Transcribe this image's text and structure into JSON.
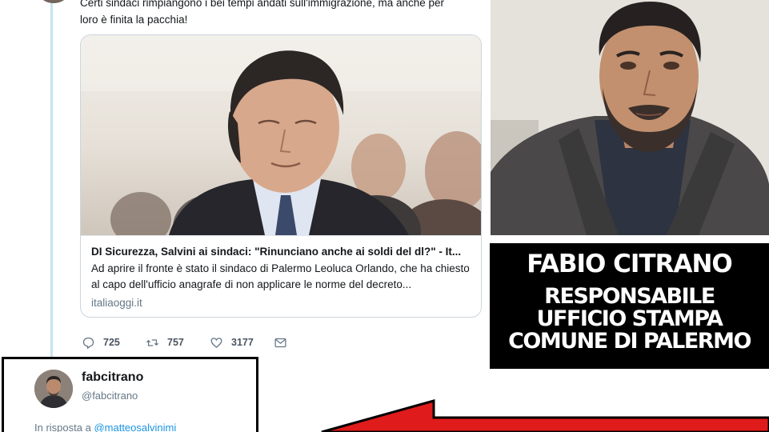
{
  "tweet": {
    "text": "Certi sindaci rimpiangono i bei tempi andati sull'immigrazione, ma anche per loro è finita la pacchia!",
    "card": {
      "title": "DI Sicurezza, Salvini ai sindaci: \"Rinunciano anche ai soldi del dl?\" - It...",
      "description": "Ad aprire il fronte è stato il sindaco di Palermo Leoluca Orlando, che ha chiesto al capo dell'ufficio anagrafe di non applicare le norme del decreto...",
      "domain": "italiaoggi.it"
    },
    "actions": {
      "replies": "725",
      "retweets": "757",
      "likes": "3177"
    }
  },
  "reply": {
    "display_name": "fabcitrano",
    "handle": "@fabcitrano",
    "in_reply_prefix": "In risposta a",
    "in_reply_handle": "@matteosalvinimi"
  },
  "caption": {
    "name": "FABIO CITRANO",
    "line1": "RESPONSABILE",
    "line2": "UFFICIO STAMPA",
    "line3": "COMUNE DI PALERMO"
  },
  "colors": {
    "twitter_blue": "#1b95e0",
    "muted_gray": "#657786",
    "arrow_red": "#e01b1b",
    "caption_bg": "#000000"
  }
}
